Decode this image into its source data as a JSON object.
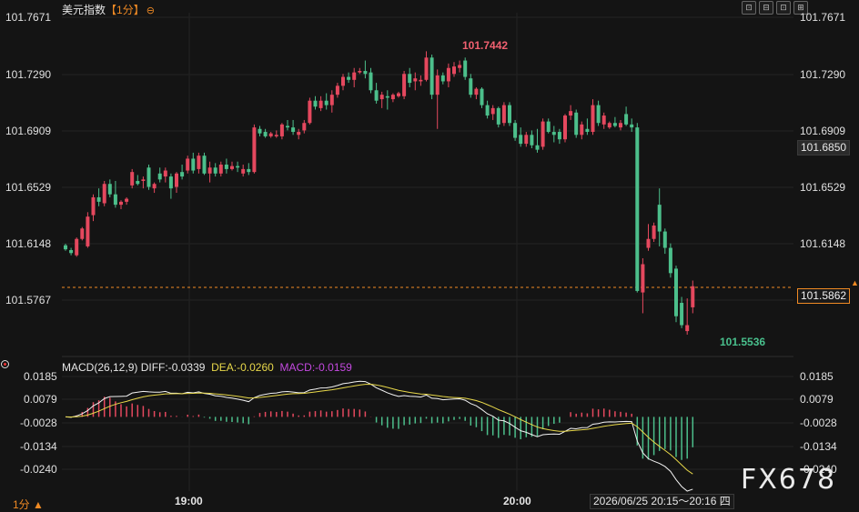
{
  "header": {
    "instrument": "美元指数",
    "period_label": "【1分】",
    "period_icon": "⊖",
    "tools": [
      "⊡",
      "⊟",
      "⊡",
      "⊞"
    ]
  },
  "price_axis": {
    "ticks_left": [
      "101.7671",
      "101.7290",
      "101.6909",
      "101.6529",
      "101.6148",
      "101.5767"
    ],
    "ticks_right": [
      "101.7671",
      "101.7290",
      "101.6909",
      "101.6529",
      "101.6148"
    ]
  },
  "tags": {
    "last_close": "101.6850",
    "current": "101.5862"
  },
  "annotations": {
    "high": "101.7442",
    "low": "101.5536"
  },
  "macd": {
    "params": "MACD(26,12,9)",
    "diff": "DIFF:-0.0339",
    "dea": "DEA:-0.0260",
    "macd": "MACD:-0.0159",
    "ticks_left": [
      "0.0185",
      "0.0079",
      "-0.0028",
      "-0.0134",
      "-0.0240"
    ],
    "ticks_right": [
      "0.0185",
      "0.0079",
      "-0.0028",
      "-0.0134",
      "-0.0240"
    ]
  },
  "time_axis": {
    "labels": [
      "19:00",
      "20:00"
    ]
  },
  "footer": {
    "period_button": "1分 ▲",
    "crosshair_time": "2026/06/25 20:15～20:16 四"
  },
  "watermark": "FX678",
  "colors": {
    "up": "#e5485e",
    "down": "#4cbf8b",
    "diff": "#f2f2f2",
    "dea": "#e8d84a",
    "accent": "#f08a24",
    "bg": "#141414"
  },
  "chart_data": {
    "type": "candlestick",
    "title": "美元指数 1分",
    "ylim": [
      101.5536,
      101.7671
    ],
    "candles": [
      {
        "o": 101.6137,
        "h": 101.6148,
        "l": 101.61,
        "c": 101.611
      },
      {
        "o": 101.6105,
        "h": 101.612,
        "l": 101.607,
        "c": 101.6085
      },
      {
        "o": 101.607,
        "h": 101.619,
        "l": 101.606,
        "c": 101.618
      },
      {
        "o": 101.618,
        "h": 101.626,
        "l": 101.617,
        "c": 101.625
      },
      {
        "o": 101.613,
        "h": 101.636,
        "l": 101.612,
        "c": 101.633
      },
      {
        "o": 101.634,
        "h": 101.648,
        "l": 101.63,
        "c": 101.646
      },
      {
        "o": 101.646,
        "h": 101.652,
        "l": 101.64,
        "c": 101.643
      },
      {
        "o": 101.642,
        "h": 101.657,
        "l": 101.64,
        "c": 101.655
      },
      {
        "o": 101.655,
        "h": 101.658,
        "l": 101.646,
        "c": 101.648
      },
      {
        "o": 101.648,
        "h": 101.657,
        "l": 101.639,
        "c": 101.641
      },
      {
        "o": 101.641,
        "h": 101.644,
        "l": 101.638,
        "c": 101.643
      },
      {
        "o": 101.643,
        "h": 101.646,
        "l": 101.641,
        "c": 101.645
      },
      {
        "o": 101.654,
        "h": 101.665,
        "l": 101.652,
        "c": 101.663
      },
      {
        "o": 101.657,
        "h": 101.661,
        "l": 101.654,
        "c": 101.655
      },
      {
        "o": 101.657,
        "h": 101.66,
        "l": 101.652,
        "c": 101.658
      },
      {
        "o": 101.666,
        "h": 101.668,
        "l": 101.651,
        "c": 101.653
      },
      {
        "o": 101.652,
        "h": 101.656,
        "l": 101.649,
        "c": 101.655
      },
      {
        "o": 101.662,
        "h": 101.666,
        "l": 101.656,
        "c": 101.658
      },
      {
        "o": 101.66,
        "h": 101.666,
        "l": 101.656,
        "c": 101.664
      },
      {
        "o": 101.66,
        "h": 101.662,
        "l": 101.645,
        "c": 101.652
      },
      {
        "o": 101.653,
        "h": 101.663,
        "l": 101.649,
        "c": 101.662
      },
      {
        "o": 101.663,
        "h": 101.668,
        "l": 101.658,
        "c": 101.66
      },
      {
        "o": 101.664,
        "h": 101.674,
        "l": 101.662,
        "c": 101.672
      },
      {
        "o": 101.672,
        "h": 101.676,
        "l": 101.662,
        "c": 101.664
      },
      {
        "o": 101.665,
        "h": 101.676,
        "l": 101.662,
        "c": 101.674
      },
      {
        "o": 101.674,
        "h": 101.676,
        "l": 101.661,
        "c": 101.662
      },
      {
        "o": 101.662,
        "h": 101.67,
        "l": 101.656,
        "c": 101.666
      },
      {
        "o": 101.666,
        "h": 101.669,
        "l": 101.66,
        "c": 101.662
      },
      {
        "o": 101.662,
        "h": 101.67,
        "l": 101.66,
        "c": 101.668
      },
      {
        "o": 101.668,
        "h": 101.672,
        "l": 101.662,
        "c": 101.665
      },
      {
        "o": 101.665,
        "h": 101.67,
        "l": 101.664,
        "c": 101.667
      },
      {
        "o": 101.667,
        "h": 101.67,
        "l": 101.663,
        "c": 101.666
      },
      {
        "o": 101.662,
        "h": 101.668,
        "l": 101.66,
        "c": 101.665
      },
      {
        "o": 101.665,
        "h": 101.669,
        "l": 101.661,
        "c": 101.663
      },
      {
        "o": 101.663,
        "h": 101.695,
        "l": 101.662,
        "c": 101.693
      },
      {
        "o": 101.692,
        "h": 101.694,
        "l": 101.687,
        "c": 101.689
      },
      {
        "o": 101.69,
        "h": 101.692,
        "l": 101.686,
        "c": 101.687
      },
      {
        "o": 101.687,
        "h": 101.69,
        "l": 101.686,
        "c": 101.689
      },
      {
        "o": 101.687,
        "h": 101.691,
        "l": 101.686,
        "c": 101.688
      },
      {
        "o": 101.687,
        "h": 101.696,
        "l": 101.685,
        "c": 101.695
      },
      {
        "o": 101.694,
        "h": 101.698,
        "l": 101.691,
        "c": 101.693
      },
      {
        "o": 101.693,
        "h": 101.698,
        "l": 101.688,
        "c": 101.69
      },
      {
        "o": 101.688,
        "h": 101.692,
        "l": 101.685,
        "c": 101.69
      },
      {
        "o": 101.691,
        "h": 101.698,
        "l": 101.689,
        "c": 101.696
      },
      {
        "o": 101.696,
        "h": 101.713,
        "l": 101.695,
        "c": 101.711
      },
      {
        "o": 101.711,
        "h": 101.714,
        "l": 101.705,
        "c": 101.707
      },
      {
        "o": 101.706,
        "h": 101.714,
        "l": 101.704,
        "c": 101.711
      },
      {
        "o": 101.711,
        "h": 101.716,
        "l": 101.705,
        "c": 101.708
      },
      {
        "o": 101.708,
        "h": 101.718,
        "l": 101.703,
        "c": 101.715
      },
      {
        "o": 101.715,
        "h": 101.723,
        "l": 101.713,
        "c": 101.721
      },
      {
        "o": 101.721,
        "h": 101.729,
        "l": 101.718,
        "c": 101.727
      },
      {
        "o": 101.727,
        "h": 101.73,
        "l": 101.723,
        "c": 101.725
      },
      {
        "o": 101.725,
        "h": 101.733,
        "l": 101.72,
        "c": 101.73
      },
      {
        "o": 101.73,
        "h": 101.733,
        "l": 101.729,
        "c": 101.731
      },
      {
        "o": 101.731,
        "h": 101.738,
        "l": 101.726,
        "c": 101.729
      },
      {
        "o": 101.73,
        "h": 101.733,
        "l": 101.716,
        "c": 101.718
      },
      {
        "o": 101.718,
        "h": 101.723,
        "l": 101.709,
        "c": 101.711
      },
      {
        "o": 101.712,
        "h": 101.717,
        "l": 101.706,
        "c": 101.715
      },
      {
        "o": 101.714,
        "h": 101.718,
        "l": 101.705,
        "c": 101.713
      },
      {
        "o": 101.712,
        "h": 101.716,
        "l": 101.71,
        "c": 101.715
      },
      {
        "o": 101.714,
        "h": 101.717,
        "l": 101.713,
        "c": 101.716
      },
      {
        "o": 101.714,
        "h": 101.731,
        "l": 101.712,
        "c": 101.729
      },
      {
        "o": 101.729,
        "h": 101.733,
        "l": 101.72,
        "c": 101.723
      },
      {
        "o": 101.724,
        "h": 101.73,
        "l": 101.718,
        "c": 101.726
      },
      {
        "o": 101.724,
        "h": 101.728,
        "l": 101.721,
        "c": 101.725
      },
      {
        "o": 101.725,
        "h": 101.7442,
        "l": 101.724,
        "c": 101.74
      },
      {
        "o": 101.74,
        "h": 101.742,
        "l": 101.712,
        "c": 101.715
      },
      {
        "o": 101.715,
        "h": 101.732,
        "l": 101.692,
        "c": 101.728
      },
      {
        "o": 101.728,
        "h": 101.73,
        "l": 101.722,
        "c": 101.724
      },
      {
        "o": 101.724,
        "h": 101.736,
        "l": 101.72,
        "c": 101.733
      },
      {
        "o": 101.729,
        "h": 101.737,
        "l": 101.727,
        "c": 101.734
      },
      {
        "o": 101.733,
        "h": 101.738,
        "l": 101.73,
        "c": 101.735
      },
      {
        "o": 101.738,
        "h": 101.74,
        "l": 101.725,
        "c": 101.727
      },
      {
        "o": 101.726,
        "h": 101.729,
        "l": 101.713,
        "c": 101.715
      },
      {
        "o": 101.715,
        "h": 101.72,
        "l": 101.712,
        "c": 101.719
      },
      {
        "o": 101.719,
        "h": 101.72,
        "l": 101.706,
        "c": 101.708
      },
      {
        "o": 101.708,
        "h": 101.711,
        "l": 101.699,
        "c": 101.701
      },
      {
        "o": 101.702,
        "h": 101.708,
        "l": 101.698,
        "c": 101.706
      },
      {
        "o": 101.706,
        "h": 101.707,
        "l": 101.693,
        "c": 101.695
      },
      {
        "o": 101.696,
        "h": 101.71,
        "l": 101.694,
        "c": 101.708
      },
      {
        "o": 101.708,
        "h": 101.71,
        "l": 101.694,
        "c": 101.696
      },
      {
        "o": 101.696,
        "h": 101.698,
        "l": 101.684,
        "c": 101.686
      },
      {
        "o": 101.688,
        "h": 101.693,
        "l": 101.68,
        "c": 101.682
      },
      {
        "o": 101.682,
        "h": 101.69,
        "l": 101.68,
        "c": 101.688
      },
      {
        "o": 101.688,
        "h": 101.691,
        "l": 101.679,
        "c": 101.681
      },
      {
        "o": 101.681,
        "h": 101.692,
        "l": 101.676,
        "c": 101.678
      },
      {
        "o": 101.68,
        "h": 101.699,
        "l": 101.678,
        "c": 101.697
      },
      {
        "o": 101.697,
        "h": 101.699,
        "l": 101.689,
        "c": 101.69
      },
      {
        "o": 101.69,
        "h": 101.694,
        "l": 101.683,
        "c": 101.688
      },
      {
        "o": 101.69,
        "h": 101.692,
        "l": 101.682,
        "c": 101.685
      },
      {
        "o": 101.685,
        "h": 101.702,
        "l": 101.683,
        "c": 101.701
      },
      {
        "o": 101.701,
        "h": 101.708,
        "l": 101.698,
        "c": 101.704
      },
      {
        "o": 101.703,
        "h": 101.705,
        "l": 101.686,
        "c": 101.688
      },
      {
        "o": 101.688,
        "h": 101.697,
        "l": 101.685,
        "c": 101.695
      },
      {
        "o": 101.692,
        "h": 101.699,
        "l": 101.688,
        "c": 101.69
      },
      {
        "o": 101.69,
        "h": 101.712,
        "l": 101.688,
        "c": 101.708
      },
      {
        "o": 101.708,
        "h": 101.711,
        "l": 101.694,
        "c": 101.696
      },
      {
        "o": 101.695,
        "h": 101.703,
        "l": 101.692,
        "c": 101.701
      },
      {
        "o": 101.693,
        "h": 101.697,
        "l": 101.692,
        "c": 101.696
      },
      {
        "o": 101.696,
        "h": 101.7,
        "l": 101.693,
        "c": 101.694
      },
      {
        "o": 101.693,
        "h": 101.698,
        "l": 101.691,
        "c": 101.696
      },
      {
        "o": 101.702,
        "h": 101.707,
        "l": 101.694,
        "c": 101.695
      },
      {
        "o": 101.695,
        "h": 101.699,
        "l": 101.69,
        "c": 101.693
      },
      {
        "o": 101.693,
        "h": 101.696,
        "l": 101.582,
        "c": 101.583
      },
      {
        "o": 101.582,
        "h": 101.605,
        "l": 101.568,
        "c": 101.601
      },
      {
        "o": 101.612,
        "h": 101.628,
        "l": 101.61,
        "c": 101.618
      },
      {
        "o": 101.618,
        "h": 101.629,
        "l": 101.616,
        "c": 101.627
      },
      {
        "o": 101.641,
        "h": 101.652,
        "l": 101.613,
        "c": 101.623
      },
      {
        "o": 101.623,
        "h": 101.625,
        "l": 101.608,
        "c": 101.612
      },
      {
        "o": 101.612,
        "h": 101.615,
        "l": 101.592,
        "c": 101.595
      },
      {
        "o": 101.598,
        "h": 101.6,
        "l": 101.562,
        "c": 101.566
      },
      {
        "o": 101.575,
        "h": 101.579,
        "l": 101.558,
        "c": 101.56
      },
      {
        "o": 101.556,
        "h": 101.578,
        "l": 101.5536,
        "c": 101.56
      },
      {
        "o": 101.572,
        "h": 101.59,
        "l": 101.568,
        "c": 101.5862
      }
    ]
  }
}
